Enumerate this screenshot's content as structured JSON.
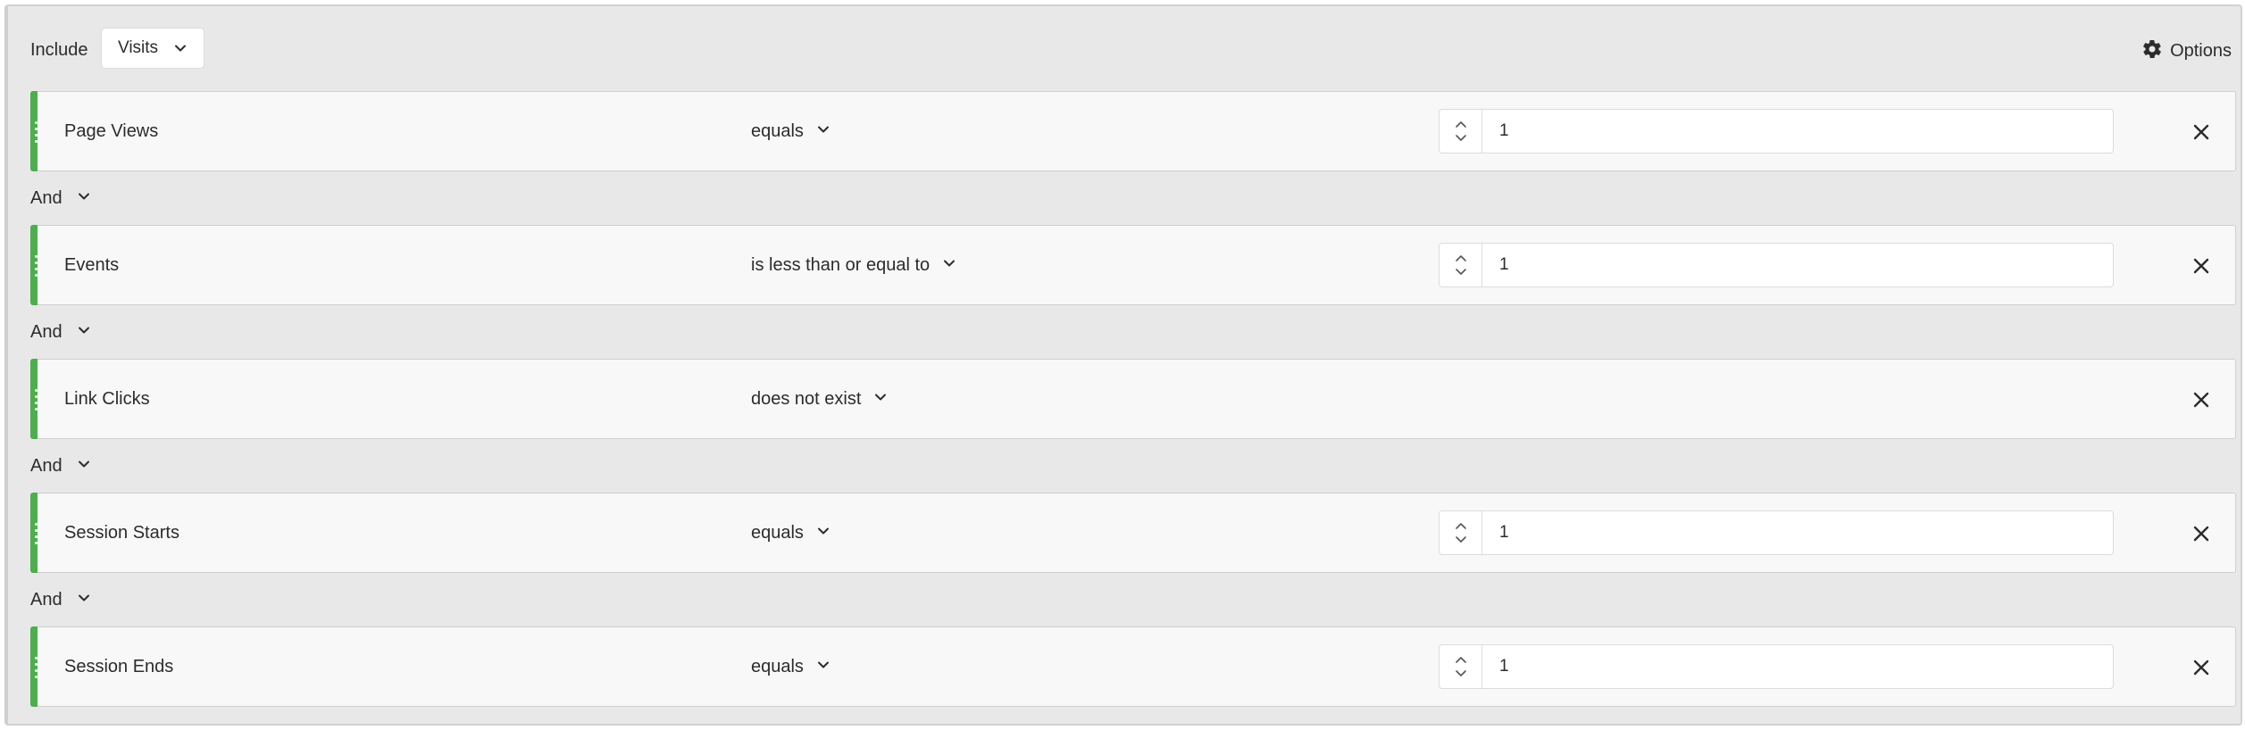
{
  "header": {
    "include_label": "Include",
    "scope_value": "Visits",
    "options_label": "Options"
  },
  "conjunction_label": "And",
  "rules": [
    {
      "name": "Page Views",
      "operator": "equals",
      "value": "1",
      "has_value": true
    },
    {
      "name": "Events",
      "operator": "is less than or equal to",
      "value": "1",
      "has_value": true
    },
    {
      "name": "Link Clicks",
      "operator": "does not exist",
      "value": "",
      "has_value": false
    },
    {
      "name": "Session Starts",
      "operator": "equals",
      "value": "1",
      "has_value": true
    },
    {
      "name": "Session Ends",
      "operator": "equals",
      "value": "1",
      "has_value": true
    }
  ],
  "colors": {
    "accent": "#4cae4c",
    "panel_bg": "#e8e8e8",
    "rule_bg": "#f8f8f8"
  },
  "icons": {
    "options": "gear-icon",
    "dropdown": "chevron-down-icon",
    "remove": "close-icon",
    "stepper_up": "chevron-up-icon",
    "stepper_down": "chevron-down-icon",
    "drag": "drag-handle-icon"
  }
}
